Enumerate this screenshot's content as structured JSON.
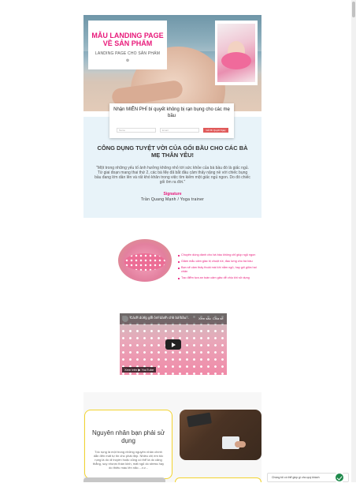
{
  "hero": {
    "title": "MẪU LANDING PAGE VỀ SẢN PHẨM",
    "subtitle": "LANDING PAGE CHO SẢN PHẨM",
    "mark": "♔"
  },
  "form": {
    "heading": "Nhận MIỄN PHÍ bí quyết không bị rạn bụng cho các mẹ bầu",
    "name_placeholder": "Name",
    "email_placeholder": "Email",
    "submit_label": "Gửi Bí Quyết Ngay"
  },
  "benefit": {
    "heading": "CÔNG DỤNG TUYỆT VỜI CỦA GỐI BẦU CHO CÁC BÀ MẸ THÂN YÊU!",
    "quote": "\"Một trong những yếu tố ảnh hưởng không nhỏ tới sức khỏe của bà bầu đó là giấc ngủ. Từ giai đoạn mang thai thứ 2, các bà Mẹ đã bắt đầu cảm thấy nặng nề với chiếc bụng bầu đang lớn dần lên và rất khó khăn trong việc tìm kiếm một giấc ngủ ngon. Do đó chiếc gối ôm ra đời.\"",
    "signature": "Signature",
    "author": "Trần Quang Mạnh / Yoga trainer"
  },
  "features": [
    "Chuyên dùng dành cho bà bầu không chỉ giúp ngủ ngon",
    "Giảm mẫu cảm giác bị chuột rút, đau lưng cho bà bầu",
    "Bạn sẽ cảm thấy thoải mái khi nằm ngủ, hay gối giữa hai chân",
    "Tạo điểm tựa an toàn cảm giác dễ chịu khi sử dụng"
  ],
  "video": {
    "title": "Cách dùng gối ôm dành cho bà bầu...",
    "watch_later": "Xem sau",
    "share": "Chia sẻ",
    "watch_label": "Xem trên ▶ YouTube"
  },
  "card": {
    "heading": "Nguyên nhân bạn phải sử dụng",
    "text": "Tốc rụng là một trong những nguyên nhân chính dẫn đến mất tự tin cho phái đẹp. Nhiều chị em tốc rụng là do di truyền hoặc cũng có thể là do căng thẳng, suy nhược thần kinh, mất ngủ do stress hay do thiếu máu lên não....v.v..."
  },
  "chat": {
    "text": "Chúng tôi có thể giúp gì cho quý khách"
  },
  "colors": {
    "accent": "#e8197a",
    "benefit_bg": "#e8f3f9",
    "card_border": "#f2d32e",
    "submit": "#e05a5a"
  }
}
